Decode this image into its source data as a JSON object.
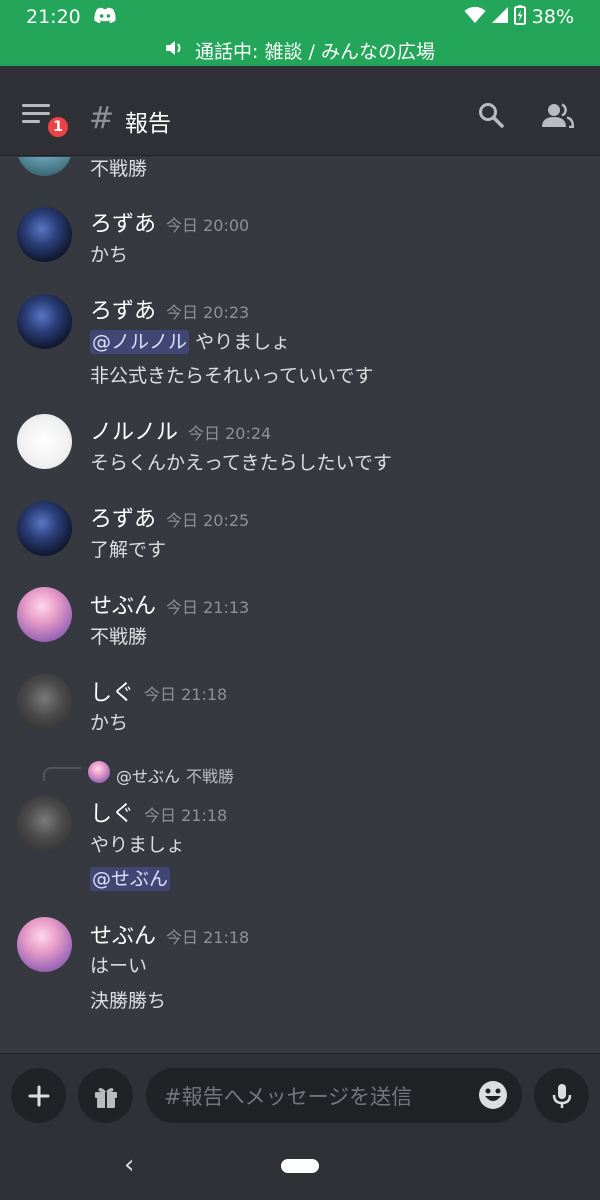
{
  "status_bar": {
    "time": "21:20",
    "battery": "38%"
  },
  "call_banner": {
    "text": "通話中: 雑談 / みんなの広場"
  },
  "header": {
    "badge_count": "1",
    "hash": "#",
    "channel_name": "報告"
  },
  "messages": [
    {
      "author": "",
      "time": "",
      "lines": [
        "不戦勝"
      ]
    },
    {
      "author": "ろずあ",
      "time": "今日 20:00",
      "lines": [
        "かち"
      ]
    },
    {
      "author": "ろずあ",
      "time": "今日 20:23",
      "mention": "@ノルノル",
      "lines": [
        "やりましょ",
        "非公式きたらそれいっていいです"
      ]
    },
    {
      "author": "ノルノル",
      "time": "今日 20:24",
      "lines": [
        "そらくんかえってきたらしたいです"
      ]
    },
    {
      "author": "ろずあ",
      "time": "今日 20:25",
      "lines": [
        "了解です"
      ]
    },
    {
      "author": "せぶん",
      "time": "今日 21:13",
      "lines": [
        "不戦勝"
      ]
    },
    {
      "author": "しぐ",
      "time": "今日 21:18",
      "lines": [
        "かち"
      ]
    },
    {
      "author": "しぐ",
      "time": "今日 21:18",
      "reply": {
        "mention": "@せぶん",
        "text": "不戦勝"
      },
      "lines": [
        "やりましょ"
      ],
      "mention_line": "@せぶん"
    },
    {
      "author": "せぶん",
      "time": "今日 21:18",
      "lines": [
        "はーい",
        "決勝勝ち"
      ]
    }
  ],
  "input": {
    "placeholder": "#報告へメッセージを送信"
  },
  "icons": {
    "menu": "menu-icon",
    "search": "search-icon",
    "members": "members-icon",
    "add": "plus-icon",
    "gift": "gift-icon",
    "emoji": "emoji-icon",
    "mic": "microphone-icon",
    "speaker": "speaker-icon",
    "discord": "discord-icon",
    "wifi": "wifi-icon",
    "signal": "signal-icon",
    "battery": "battery-icon",
    "back": "back-icon"
  },
  "colors": {
    "call_green": "#23a55a",
    "background": "#36393f",
    "header": "#2f3136",
    "badge": "#ed4245",
    "mention_bg": "#414675"
  }
}
